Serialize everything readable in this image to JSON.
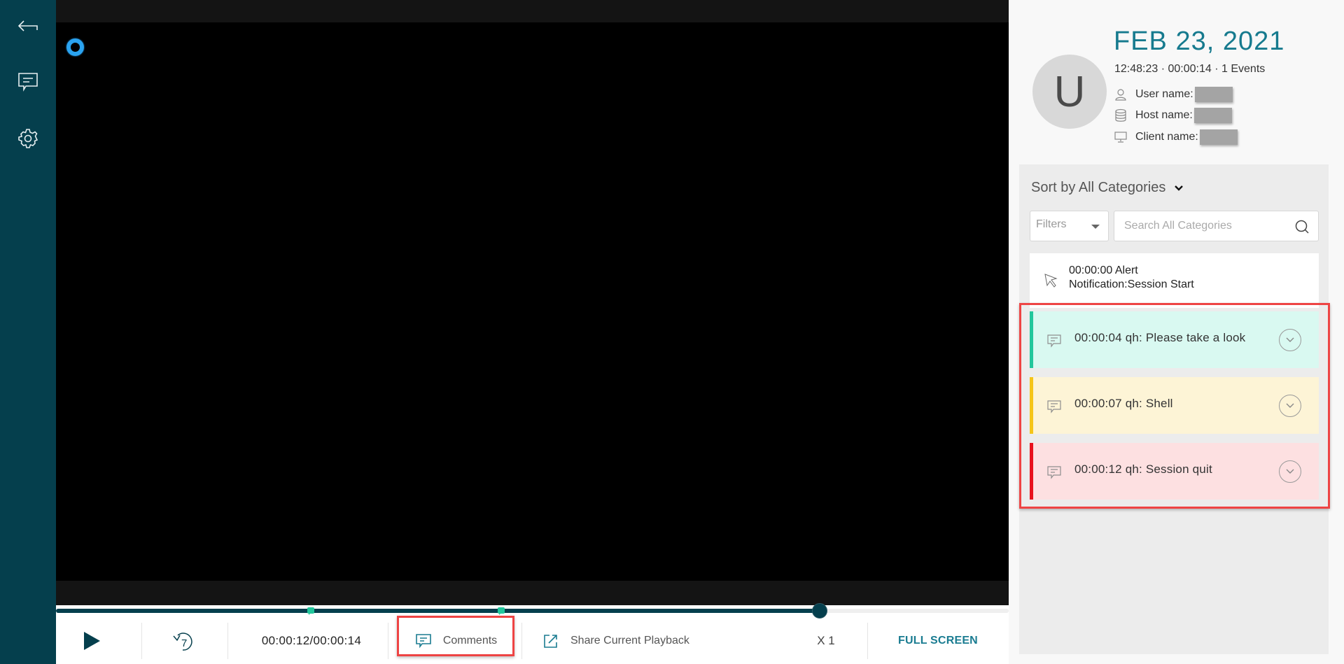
{
  "nav": {
    "items": [
      {
        "name": "back",
        "icon": "back-arrow-icon"
      },
      {
        "name": "comments",
        "icon": "comment-icon"
      },
      {
        "name": "settings",
        "icon": "gear-icon"
      }
    ]
  },
  "player": {
    "timeline": {
      "progress_fraction": 0.857,
      "current_seconds": 12,
      "total_seconds": 14,
      "comment_markers_seconds": [
        4,
        7
      ]
    },
    "controls": {
      "play_icon": "play-icon",
      "rewind_seconds": "7",
      "time_display": "00:00:12/00:00:14",
      "comments_label": "Comments",
      "share_label": "Share Current Playback",
      "speed_label": "X 1",
      "fullscreen_label": "FULL SCREEN"
    }
  },
  "session": {
    "avatar_letter": "U",
    "date": "FEB 23, 2021",
    "meta": "12:48:23 · 00:00:14 · 1 Events",
    "user_name_label": "User name:",
    "host_name_label": "Host name:",
    "client_name_label": "Client name:"
  },
  "events_panel": {
    "sort_label": "Sort by All Categories",
    "filters_label": "Filters",
    "search_placeholder": "Search All Categories",
    "events": [
      {
        "line1": "00:00:00 Alert",
        "line2": "Notification:Session Start",
        "icon": "cursor-icon"
      }
    ],
    "comments": [
      {
        "text": "00:00:04 qh: Please take a look",
        "accent": "#22c79c",
        "bg": "#d9f9f1"
      },
      {
        "text": "00:00:07 qh: Shell",
        "accent": "#f5c518",
        "bg": "#fdf4d6"
      },
      {
        "text": "00:00:12 qh: Session quit",
        "accent": "#e8121d",
        "bg": "#fde0e1"
      }
    ]
  },
  "colors": {
    "nav_bg": "#053f4d",
    "accent_teal": "#167a8e",
    "highlight_red": "#ee4444"
  }
}
